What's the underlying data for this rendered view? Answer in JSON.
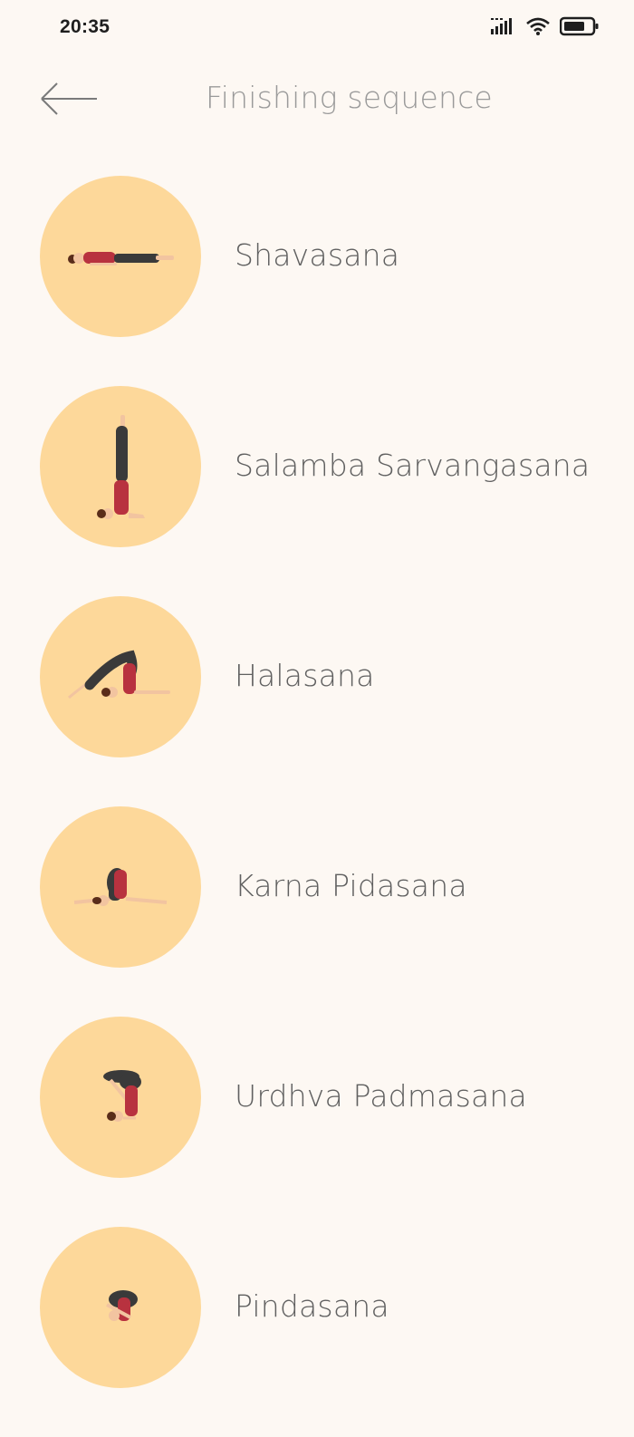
{
  "status_bar": {
    "time": "20:35",
    "icons": [
      "signal-icon",
      "wifi-icon",
      "battery-icon"
    ]
  },
  "header": {
    "back_icon": "arrow-left-icon",
    "title": "Finishing sequence"
  },
  "theme": {
    "background": "#fdf8f3",
    "circle": "#fdd89a",
    "top_color": "#b8323f",
    "pants_color": "#3a3a3a",
    "skin_color": "#f2c4a0",
    "hair_color": "#5a2d1a"
  },
  "poses": [
    {
      "name": "Shavasana",
      "icon": "shavasana-pose-icon"
    },
    {
      "name": "Salamba Sarvangasana",
      "icon": "shoulder-stand-pose-icon"
    },
    {
      "name": "Halasana",
      "icon": "plow-pose-icon"
    },
    {
      "name": "Karna Pidasana",
      "icon": "ear-pressure-pose-icon"
    },
    {
      "name": "Urdhva Padmasana",
      "icon": "upward-lotus-pose-icon"
    },
    {
      "name": "Pindasana",
      "icon": "embryo-pose-icon"
    }
  ]
}
